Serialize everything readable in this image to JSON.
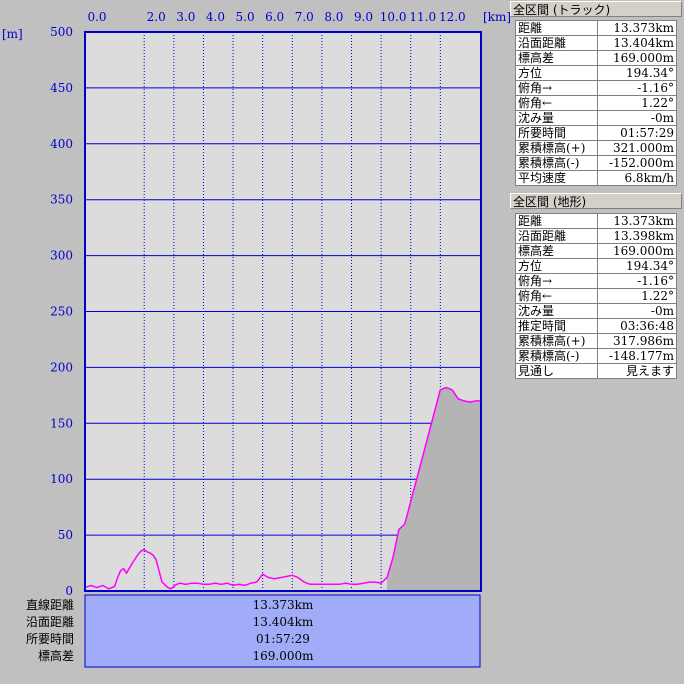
{
  "chart_data": {
    "type": "area",
    "x_unit_label": "[km]",
    "y_unit_label": "[m]",
    "x_ticks": [
      "0.0",
      "2.0",
      "3.0",
      "4.0",
      "5.0",
      "6.0",
      "7.0",
      "8.0",
      "9.0",
      "10.0",
      "11.0",
      "12.0"
    ],
    "x_tick_values": [
      0,
      2,
      3,
      4,
      5,
      6,
      7,
      8,
      9,
      10,
      11,
      12
    ],
    "y_ticks": [
      0,
      50,
      100,
      150,
      200,
      250,
      300,
      350,
      400,
      450,
      500
    ],
    "xlim": [
      0,
      13.373
    ],
    "ylim": [
      0,
      500
    ],
    "grid": true,
    "series": [
      {
        "x": [
          0,
          0.2,
          0.4,
          0.6,
          0.8,
          1.0,
          1.1,
          1.2,
          1.3,
          1.4,
          1.6,
          1.8,
          1.9,
          2.0,
          2.1,
          2.2,
          2.3,
          2.4,
          2.6,
          2.8,
          2.9,
          3.0,
          3.1,
          3.2,
          3.4,
          3.6,
          3.8,
          4.0,
          4.2,
          4.4,
          4.6,
          4.8,
          5.0,
          5.2,
          5.4,
          5.6,
          5.8,
          6.0,
          6.2,
          6.4,
          6.6,
          6.8,
          7.0,
          7.2,
          7.4,
          7.6,
          7.8,
          8.0,
          8.2,
          8.4,
          8.6,
          8.8,
          9.0,
          9.2,
          9.4,
          9.6,
          9.8,
          10.0,
          10.2,
          10.4,
          10.6,
          10.8,
          11.0,
          11.2,
          11.4,
          11.6,
          11.8,
          12.0,
          12.2,
          12.4,
          12.6,
          12.8,
          13.0,
          13.2,
          13.373
        ],
        "y": [
          3,
          5,
          3,
          5,
          2,
          4,
          12,
          18,
          20,
          16,
          25,
          33,
          36,
          37,
          35,
          34,
          32,
          28,
          8,
          3,
          2,
          4,
          6,
          7,
          6,
          7,
          7,
          6,
          6,
          7,
          6,
          7,
          5,
          6,
          5,
          7,
          8,
          15,
          12,
          11,
          12,
          13,
          14,
          12,
          8,
          6,
          6,
          6,
          6,
          6,
          6,
          7,
          6,
          6,
          7,
          8,
          8,
          7,
          12,
          30,
          55,
          60,
          80,
          100,
          120,
          140,
          160,
          180,
          182,
          180,
          172,
          170,
          169,
          170,
          170
        ]
      }
    ]
  },
  "track": {
    "title": "全区間 (トラック)",
    "rows": [
      {
        "label": "距離",
        "value": "13.373km"
      },
      {
        "label": "沿面距離",
        "value": "13.404km"
      },
      {
        "label": "標高差",
        "value": "169.000m"
      },
      {
        "label": "方位",
        "value": "194.34°"
      },
      {
        "label": "俯角→",
        "value": "-1.16°"
      },
      {
        "label": "俯角←",
        "value": "1.22°"
      },
      {
        "label": "沈み量",
        "value": "-0m"
      },
      {
        "label": "所要時間",
        "value": "01:57:29"
      },
      {
        "label": "累積標高(+)",
        "value": "321.000m"
      },
      {
        "label": "累積標高(-)",
        "value": "-152.000m"
      },
      {
        "label": "平均速度",
        "value": "6.8km/h"
      }
    ]
  },
  "terrain": {
    "title": "全区間 (地形)",
    "rows": [
      {
        "label": "距離",
        "value": "13.373km"
      },
      {
        "label": "沿面距離",
        "value": "13.398km"
      },
      {
        "label": "標高差",
        "value": "169.000m"
      },
      {
        "label": "方位",
        "value": "194.34°"
      },
      {
        "label": "俯角→",
        "value": "-1.16°"
      },
      {
        "label": "俯角←",
        "value": "1.22°"
      },
      {
        "label": "沈み量",
        "value": "-0m"
      },
      {
        "label": "推定時間",
        "value": "03:36:48"
      },
      {
        "label": "累積標高(+)",
        "value": "317.986m"
      },
      {
        "label": "累積標高(-)",
        "value": "-148.177m"
      },
      {
        "label": "見通し",
        "value": "見えます"
      }
    ]
  },
  "summary": {
    "rows": [
      {
        "label": "直線距離",
        "value": "13.373km"
      },
      {
        "label": "沿面距離",
        "value": "13.404km"
      },
      {
        "label": "所要時間",
        "value": "01:57:29"
      },
      {
        "label": "標高差",
        "value": "169.000m"
      }
    ]
  },
  "colors": {
    "axis": "#0000cc",
    "grid": "#0000cc",
    "profile": "#ff00ff",
    "fill": "#b4b4b4",
    "plot_bg": "#dcdcdc",
    "summary_bg": "#a0acf8"
  }
}
